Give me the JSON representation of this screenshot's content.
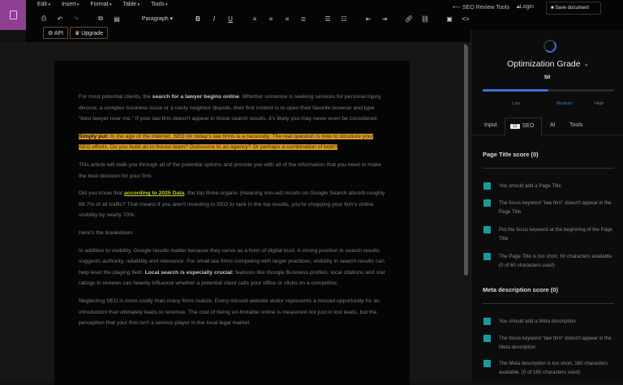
{
  "menu": [
    "Edit",
    "Insert",
    "Format",
    "Table",
    "Tools"
  ],
  "toolbar": {
    "paragraph": "Paragraph ▾",
    "api": "API",
    "upgrade": "Upgrade"
  },
  "header": {
    "seo_tools": "SEO Review Tools",
    "login": "Login",
    "save": "Save document"
  },
  "document": {
    "p1_a": "For most potential clients, the ",
    "p1_b": "search for a lawyer begins online",
    "p1_c": ". Whether someone is seeking services for personal injury, divorce, a complex business issue or a nasty neighbor dispute, their first instinct is to open their favorite browser and type \"best lawyer near me.\" If your law firm doesn't appear in those search results, it's likely you may never even be considered.",
    "p2_a": "Simply put:",
    "p2_b": " In the age of the internet, SEO for today's law firms is a necessity. The real question is how to structure your SEO efforts. Do you build an in-house team? Outsource to an agency? Or perhaps a combination of both?",
    "p3": "This article will walk you through all of the potential options and provide you with all of the information that you need to make the best decision for your firm.",
    "p4_a": "Did you know that ",
    "p4_link": "according to 2025 Data",
    "p4_b": ", the top three organic (meaning non-ad) results on Google Search absorb roughly 68.7% of all traffic? That means if you aren't investing in SEO to rank in the top results, you're chopping your firm's online visibility by nearly 70%.",
    "p5": "Here's the breakdown:",
    "p6_a": "In addition to visibility, Google results matter because they serve as a form of digital trust. A strong position in search results suggests authority, reliability and relevance. For small law firms competing with larger practices, visibility in search results can help level the playing field. ",
    "p6_b": "Local search is especially crucial:",
    "p6_c": " features like Google Business profiles, local citations and star ratings in reviews can heavily influence whether a potential client calls your office or clicks on a competitor.",
    "p7": "Neglecting SEO is more costly than many firms realize. Every missed website visitor represents a missed opportunity for an introduction that ultimately leads to revenue. The cost of being un-findable online is measured not just in lost leads, but the perception that your firm isn't a serious player in the local legal market."
  },
  "panel": {
    "title": "Optimization Grade",
    "grade_value": "50",
    "grade_percent": 50,
    "levels": [
      "Low",
      "Medium",
      "High"
    ],
    "tabs": {
      "input": "Input",
      "seo_badge": "12",
      "seo": "SEO",
      "ai": "AI",
      "tools": "Tools"
    },
    "page_title_score": "Page Title score (0)",
    "page_title_items": [
      "You should add a Page Title",
      "The focus keyword \"law firm\" doesn't appear in the Page Title",
      "Put the focus keyword at the beginning of the Page Title",
      "The Page Title is too short, 60 characters available. (0 of 60 characters used)"
    ],
    "meta_score": "Meta description score (0)",
    "meta_items": [
      "You should add a Meta description",
      "The focus keyword \"law firm\" doesn't appear in the Meta description",
      "The Meta description is too short, 160 characters available. (0 of 160 characters used)"
    ],
    "colors": {
      "accent": "#3c6fe0",
      "check": "#1b9a9e"
    }
  }
}
